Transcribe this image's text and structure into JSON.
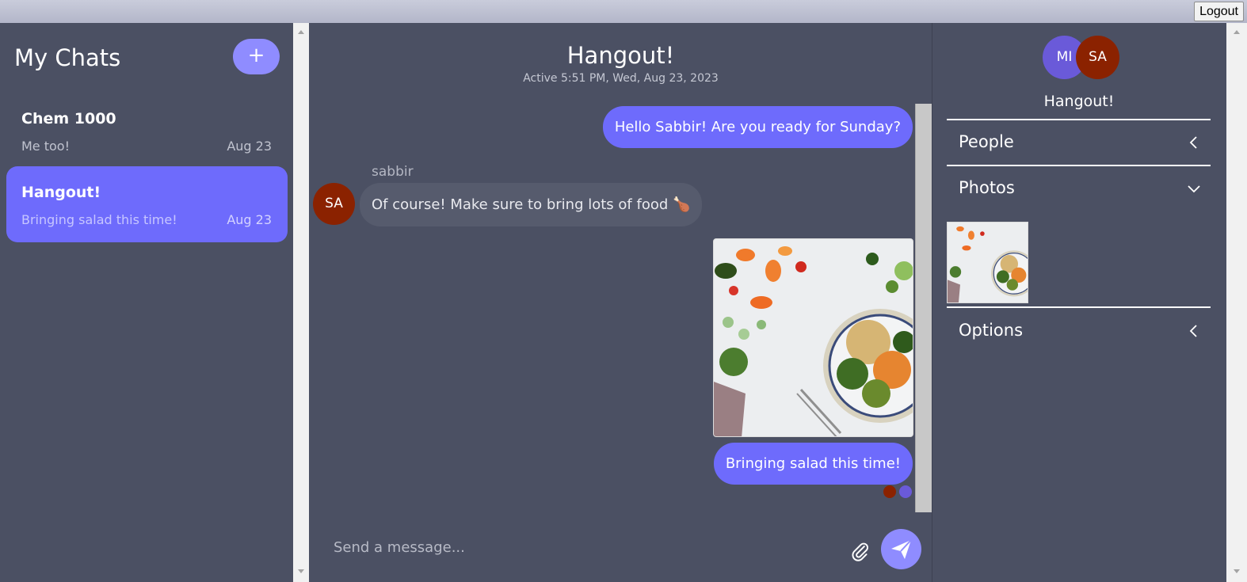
{
  "topbar": {
    "logout_label": "Logout"
  },
  "sidebar": {
    "title": "My Chats",
    "new_chat_symbol": "+",
    "chats": [
      {
        "name": "Chem 1000",
        "preview": "Me too!",
        "date": "Aug 23",
        "active": false
      },
      {
        "name": "Hangout!",
        "preview": "Bringing salad this time!",
        "date": "Aug 23",
        "active": true
      }
    ]
  },
  "chat": {
    "title": "Hangout!",
    "subtitle": "Active 5:51 PM, Wed, Aug 23, 2023",
    "messages": [
      {
        "direction": "out",
        "text": "Hello Sabbir! Are you ready for Sunday?"
      },
      {
        "direction": "in",
        "sender": "sabbir",
        "avatar": "SA",
        "text": "Of course! Make sure to bring lots of food 🍗"
      },
      {
        "direction": "out",
        "type": "image",
        "image_icon": "salad-photo"
      },
      {
        "direction": "out",
        "text": "Bringing salad this time!"
      }
    ],
    "read_receipt_colors": [
      "#8b2200",
      "#6a5ad9"
    ],
    "composer": {
      "placeholder": "Send a message..."
    }
  },
  "details": {
    "avatars": [
      {
        "initials": "MI",
        "color": "#6a5ad9"
      },
      {
        "initials": "SA",
        "color": "#8b2200"
      }
    ],
    "title": "Hangout!",
    "sections": [
      {
        "label": "People",
        "state": "collapsed"
      },
      {
        "label": "Photos",
        "state": "expanded"
      },
      {
        "label": "Options",
        "state": "collapsed"
      }
    ]
  },
  "colors": {
    "accent": "#6e6bfc",
    "accent_light": "#8f8cff",
    "background": "#4b5063"
  }
}
